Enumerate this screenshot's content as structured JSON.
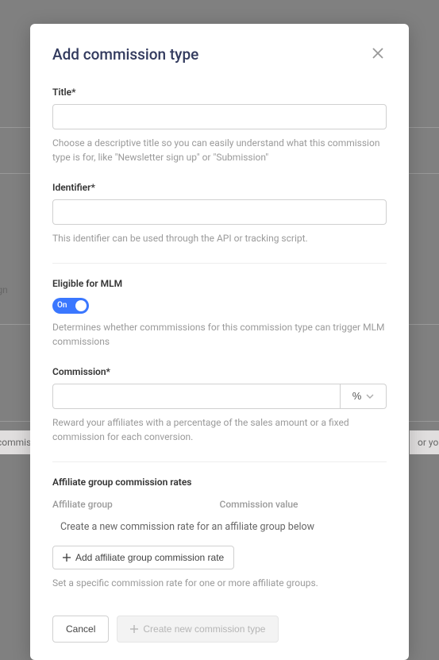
{
  "bg": {
    "signup_snippet": "ter sign",
    "commis_snippet": "commis",
    "your_snippet": "or your"
  },
  "modal": {
    "title": "Add commission type"
  },
  "title_field": {
    "label": "Title*",
    "help": "Choose a descriptive title so you can easily understand what this commission type is for, like \"Newsletter sign up\" or \"Submission\""
  },
  "identifier_field": {
    "label": "Identifier*",
    "help": "This identifier can be used through the API or tracking script."
  },
  "mlm": {
    "label": "Eligible for MLM",
    "toggle_state": "On",
    "help": "Determines whether commmissions for this commission type can trigger MLM commissions"
  },
  "commission": {
    "label": "Commission*",
    "unit": "%",
    "help": "Reward your affiliates with a percentage of the sales amount or a fixed commission for each conversion."
  },
  "group_rates": {
    "section_title": "Affiliate group commission rates",
    "col_group": "Affiliate group",
    "col_value": "Commission value",
    "empty": "Create a new commission rate for an affiliate group below",
    "add_btn": "Add affiliate group commission rate",
    "help": "Set a specific commission rate for one or more affiliate groups."
  },
  "footer": {
    "cancel": "Cancel",
    "create": "Create new commission type"
  }
}
